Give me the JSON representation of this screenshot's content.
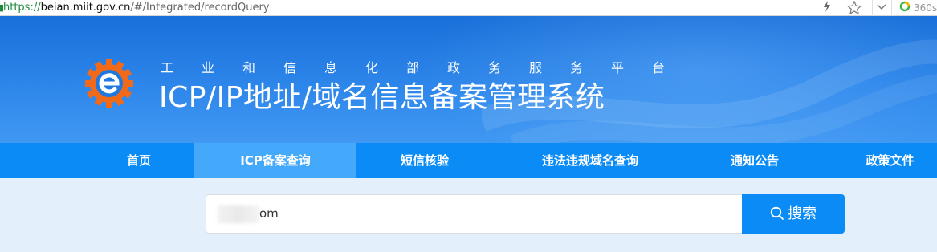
{
  "browser": {
    "url_scheme": "https://",
    "url_host": "beian.miit.gov.cn",
    "url_path": "/#/Integrated/recordQuery",
    "ext_label": "360s",
    "icons": [
      "lock-icon",
      "lightning-icon",
      "star-icon",
      "chevron-down-icon",
      "360-icon"
    ]
  },
  "header": {
    "subtitle": "工业和信息化部政务服务平台",
    "subtitle_chars": [
      "工",
      "业",
      "和",
      "信",
      "息",
      "化",
      "部",
      "政",
      "务",
      "服",
      "务",
      "平",
      "台"
    ],
    "title": "ICP/IP地址/域名信息备案管理系统",
    "colors": {
      "banner_top": "#1a6fd9",
      "banner_bottom": "#4198f2",
      "logo_orange": "#f06a1a"
    }
  },
  "nav": {
    "items": [
      {
        "label": "首页"
      },
      {
        "label": "ICP备案查询"
      },
      {
        "label": "短信核验"
      },
      {
        "label": "违法违规域名查询"
      },
      {
        "label": "通知公告"
      },
      {
        "label": "政策文件"
      }
    ],
    "active_index": 1,
    "colors": {
      "bar": "#0a8bf5",
      "active": "#45a9fb"
    }
  },
  "search": {
    "value": "om",
    "button_label": "搜索",
    "colors": {
      "button": "#0a8bf5",
      "area_bg": "#e3f0fb"
    }
  }
}
